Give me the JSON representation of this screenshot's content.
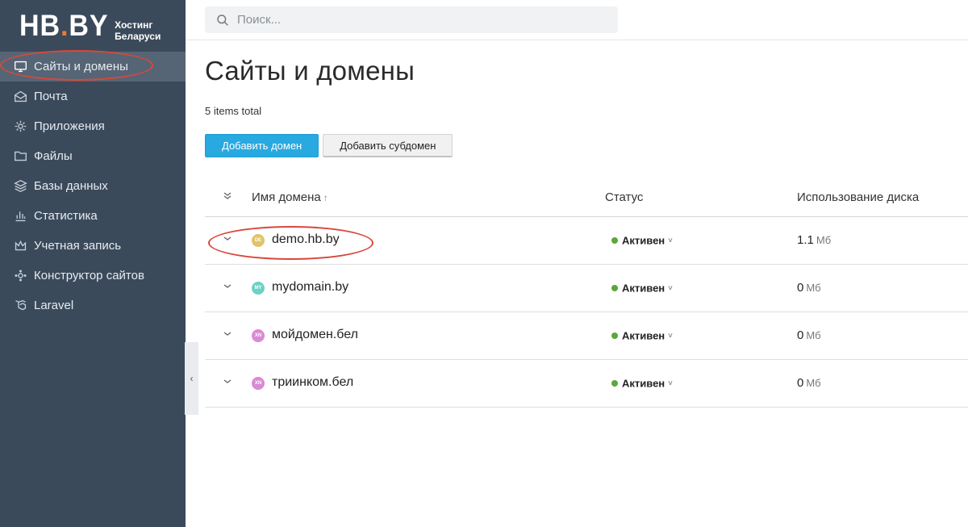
{
  "logo": {
    "main": "HB",
    "dot": ".",
    "tld": "BY",
    "tagline": "Хостинг Беларуси"
  },
  "sidebar": {
    "items": [
      {
        "label": "Сайты и домены",
        "icon": "monitor-icon",
        "active": true
      },
      {
        "label": "Почта",
        "icon": "mail-icon"
      },
      {
        "label": "Приложения",
        "icon": "gear-icon"
      },
      {
        "label": "Файлы",
        "icon": "folder-icon"
      },
      {
        "label": "Базы данных",
        "icon": "database-icon"
      },
      {
        "label": "Статистика",
        "icon": "bar-chart-icon"
      },
      {
        "label": "Учетная запись",
        "icon": "crown-icon"
      },
      {
        "label": "Конструктор сайтов",
        "icon": "sitebuilder-icon"
      },
      {
        "label": "Laravel",
        "icon": "laravel-icon"
      }
    ]
  },
  "search": {
    "placeholder": "Поиск..."
  },
  "main": {
    "title": "Сайты и домены",
    "items_total": "5 items total",
    "add_domain_label": "Добавить домен",
    "add_subdomain_label": "Добавить субдомен"
  },
  "table": {
    "headers": {
      "name": "Имя домена",
      "sort_indicator": "↑",
      "status": "Статус",
      "disk": "Использование диска"
    },
    "rows": [
      {
        "badge": "DE",
        "badge_color": "#e0c46a",
        "name": "demo.hb.by",
        "status": "Активен",
        "disk_value": "1.1",
        "disk_unit": "Мб"
      },
      {
        "badge": "MY",
        "badge_color": "#6fd0c4",
        "name": "mydomain.by",
        "status": "Активен",
        "disk_value": "0",
        "disk_unit": "Мб"
      },
      {
        "badge": "XN",
        "badge_color": "#d98ad6",
        "name": "мойдомен.бел",
        "status": "Активен",
        "disk_value": "0",
        "disk_unit": "Мб"
      },
      {
        "badge": "XN",
        "badge_color": "#d98ad6",
        "name": "триинком.бел",
        "status": "Активен",
        "disk_value": "0",
        "disk_unit": "Мб"
      }
    ]
  },
  "colors": {
    "sidebar_bg": "#3b4a5b",
    "active_item_bg": "#566575",
    "primary_button": "#28a9e0",
    "status_active": "#5aa83a",
    "highlight_circle": "#d9473b"
  }
}
